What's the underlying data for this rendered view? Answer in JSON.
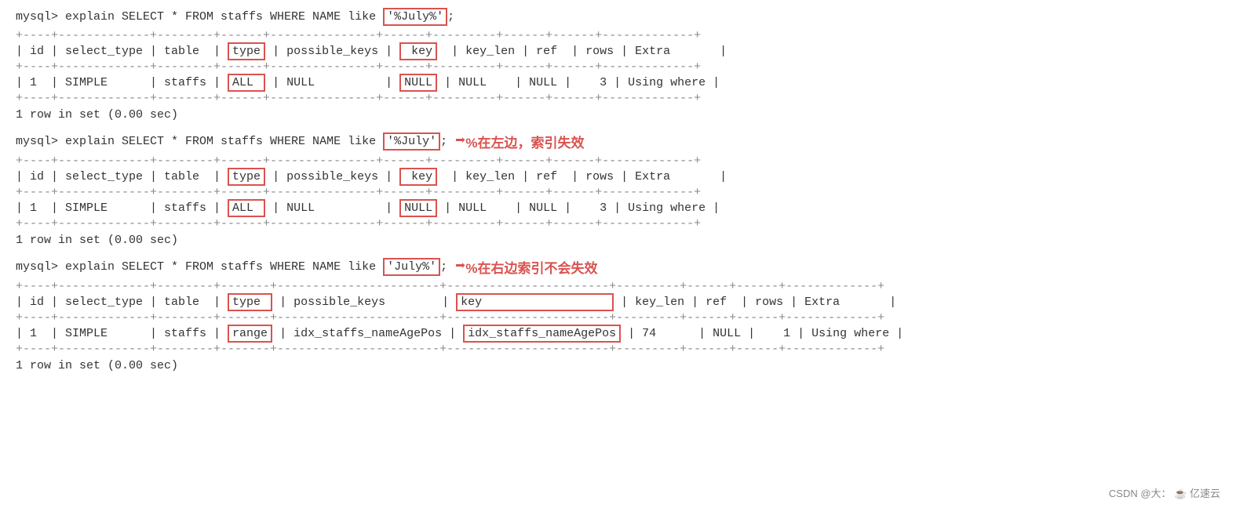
{
  "sections": [
    {
      "id": "section1",
      "sql_prefix": "mysql> explain SELECT * FROM staffs WHERE NAME like ",
      "sql_value": "'%July%'",
      "sql_suffix": ";",
      "annotation": null,
      "header_row": "| id | select_type | table  | type | possible_keys | key  | key_len | ref  | rows | Extra       |",
      "data_row": "| 1  | SIMPLE      | staffs | ALL  | NULL          | NULL | NULL    | NULL | 3    | Using where |",
      "row_count": "1 row in set (0.00 sec)"
    },
    {
      "id": "section2",
      "sql_prefix": "mysql> explain SELECT * FROM staffs WHERE NAME like ",
      "sql_value": "'%July'",
      "sql_suffix": ";",
      "annotation": "%在左边，索引失效",
      "header_row": "| id | select_type | table  | type | possible_keys | key  | key_len | ref  | rows | Extra       |",
      "data_row": "| 1  | SIMPLE      | staffs | ALL  | NULL          | NULL | NULL    | NULL | 3    | Using where |",
      "row_count": "1 row in set (0.00 sec)"
    },
    {
      "id": "section3",
      "sql_prefix": "mysql> explain SELECT * FROM staffs WHERE NAME like ",
      "sql_value": "'July%'",
      "sql_suffix": ";",
      "annotation": "%在右边索引不会失效",
      "header_row": "| id | select_type | table  | type  | possible_keys        | key                  | key_len | ref  | rows | Extra       |",
      "data_row": "| 1  | SIMPLE      | staffs | range | idx_staffs_nameAgePos | idx_staffs_nameAgePos | 74      | NULL | 1    | Using where |",
      "row_count": "1 row in set (0.00 sec)"
    }
  ],
  "footer": {
    "text": "CSDN @大：",
    "brand": "亿速云"
  }
}
